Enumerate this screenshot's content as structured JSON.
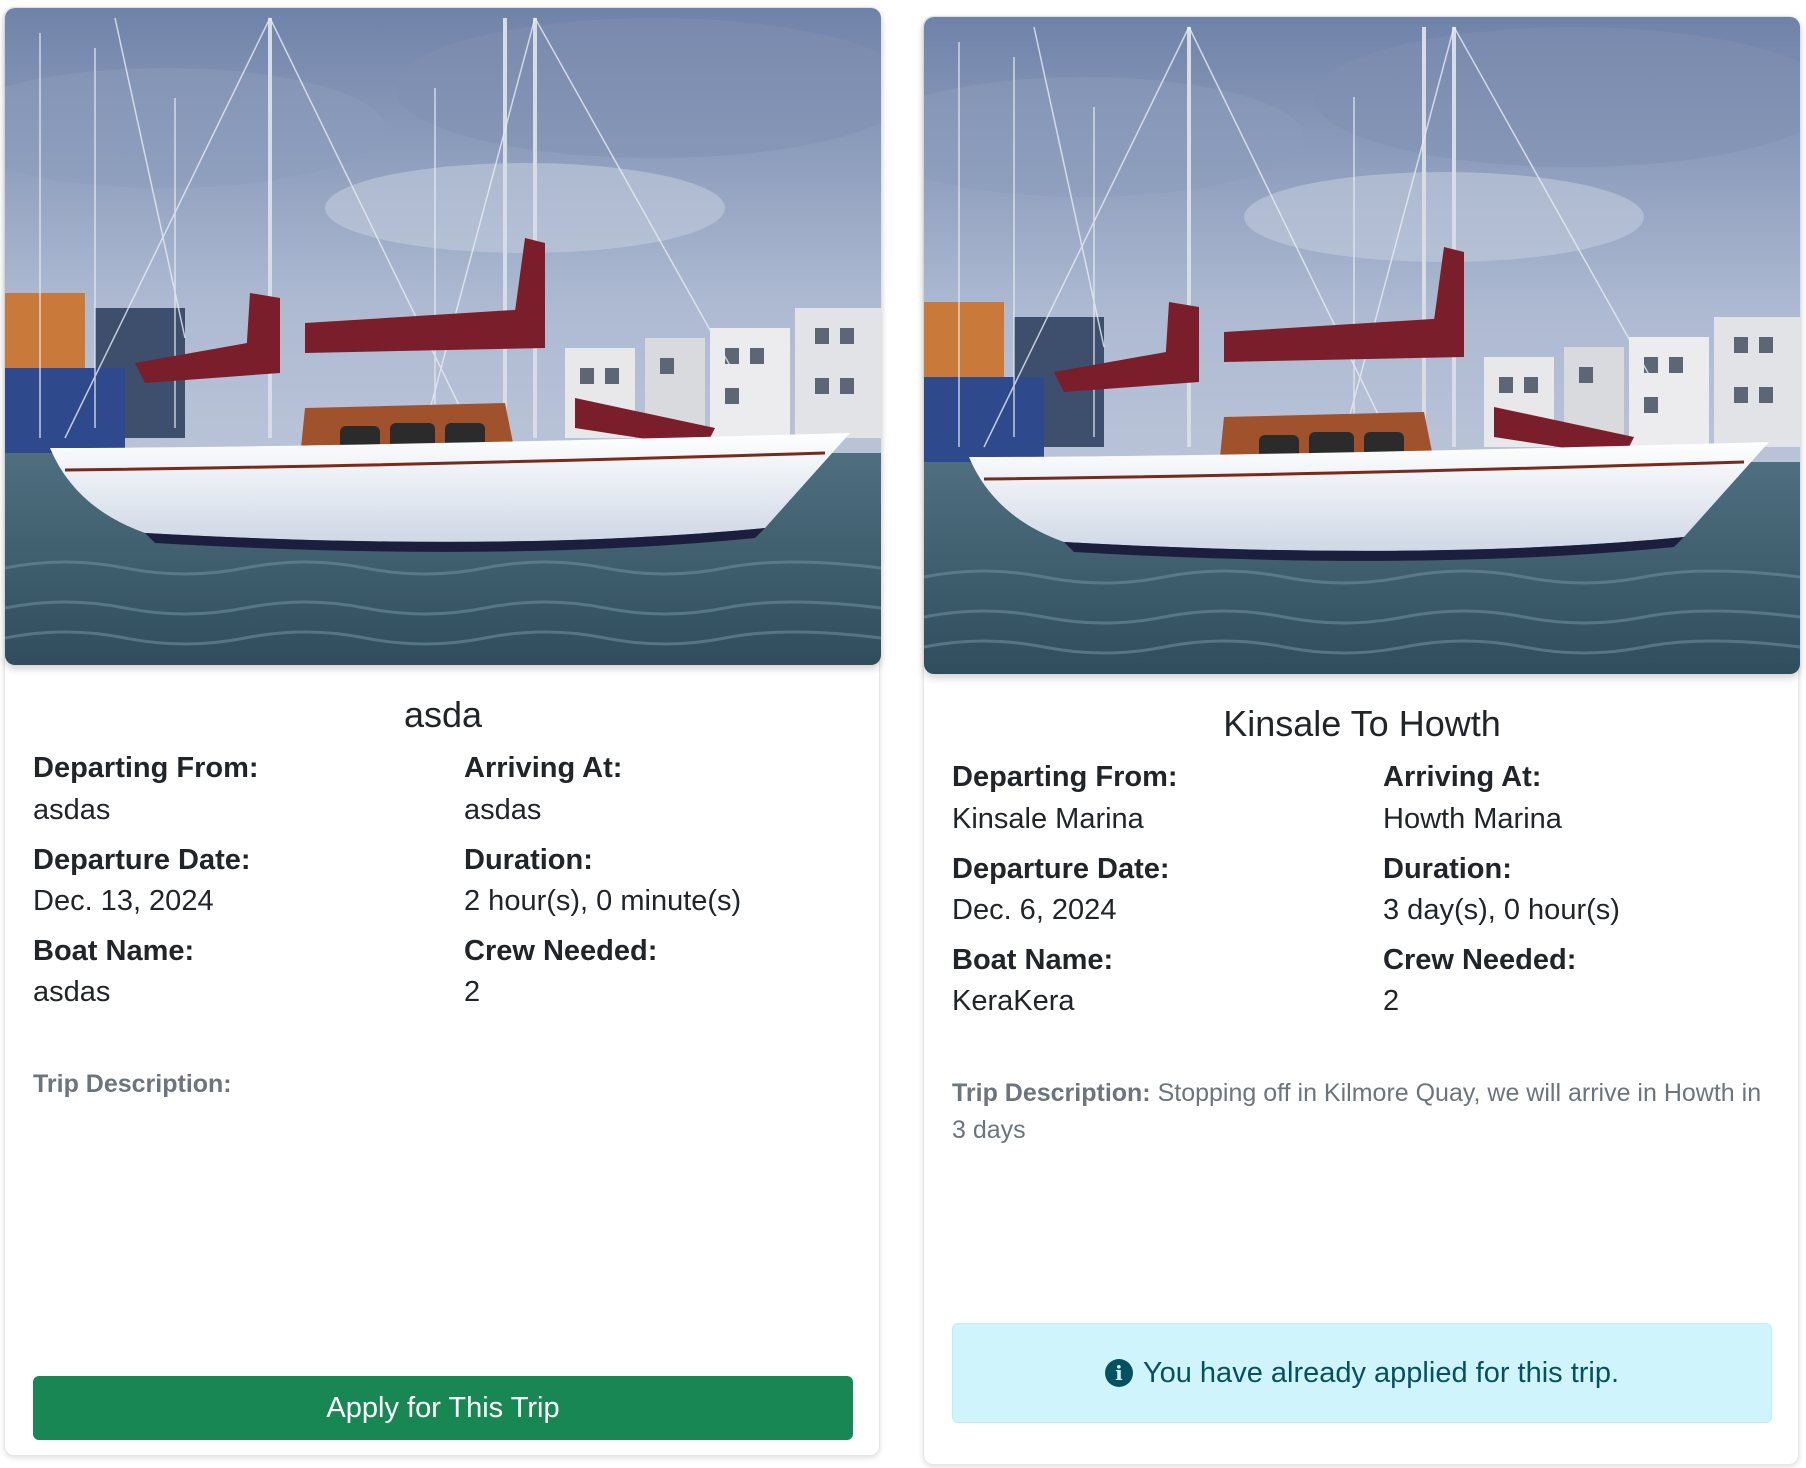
{
  "trips": [
    {
      "title": "asda",
      "departing_from_label": "Departing From:",
      "departing_from": "asdas",
      "arriving_at_label": "Arriving At:",
      "arriving_at": "asdas",
      "departure_date_label": "Departure Date:",
      "departure_date": "Dec. 13, 2024",
      "duration_label": "Duration:",
      "duration": "2 hour(s), 0 minute(s)",
      "boat_name_label": "Boat Name:",
      "boat_name": "asdas",
      "crew_needed_label": "Crew Needed:",
      "crew_needed": "2",
      "description_label": "Trip Description:",
      "description": "",
      "action_label": "Apply for This Trip"
    },
    {
      "title": "Kinsale To Howth",
      "departing_from_label": "Departing From:",
      "departing_from": "Kinsale Marina",
      "arriving_at_label": "Arriving At:",
      "arriving_at": "Howth Marina",
      "departure_date_label": "Departure Date:",
      "departure_date": "Dec. 6, 2024",
      "duration_label": "Duration:",
      "duration": "3 day(s), 0 hour(s)",
      "boat_name_label": "Boat Name:",
      "boat_name": "KeraKera",
      "crew_needed_label": "Crew Needed:",
      "crew_needed": "2",
      "description_label": "Trip Description:",
      "description": "Stopping off in Kilmore Quay, we will arrive in Howth in 3 days",
      "status_message": "You have already applied for this trip."
    }
  ],
  "icons": {
    "info": "info-circle-icon"
  },
  "colors": {
    "apply_button": "#198754",
    "info_alert_bg": "#cff4fc",
    "info_alert_text": "#055160",
    "muted_text": "#6c757d",
    "sail_cover": "#7a1e2c"
  }
}
